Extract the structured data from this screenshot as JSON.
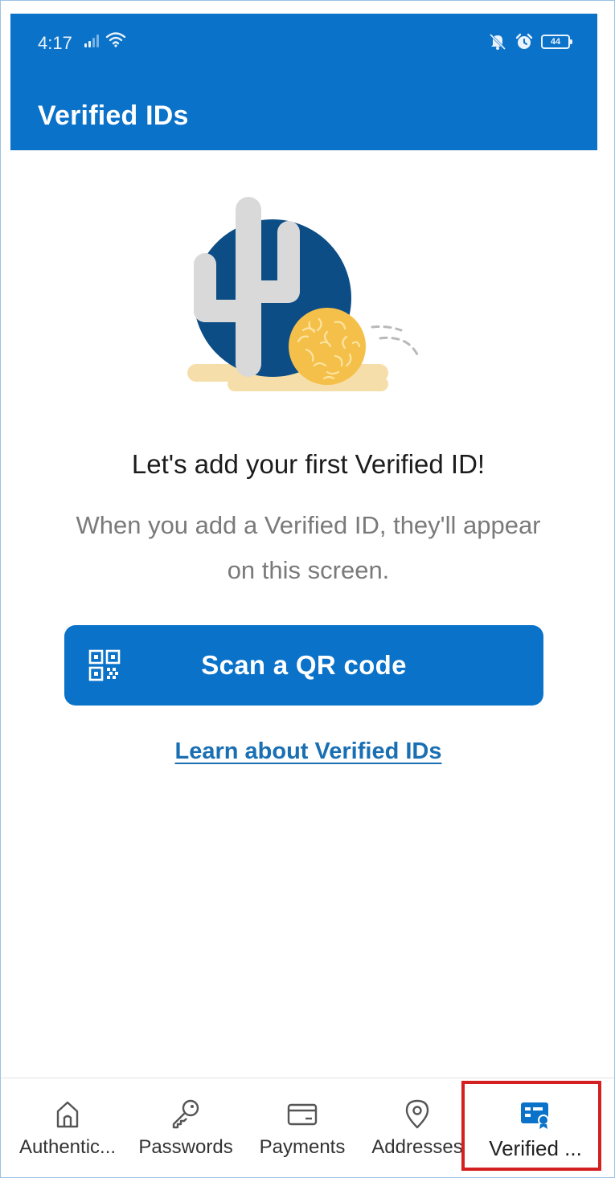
{
  "status_bar": {
    "time": "4:17",
    "battery": "44"
  },
  "header": {
    "title": "Verified IDs"
  },
  "empty_state": {
    "title": "Let's add your first Verified ID!",
    "subtitle": "When you add a Verified ID, they'll appear on this screen."
  },
  "actions": {
    "scan_label": "Scan a QR code",
    "learn_link": "Learn about Verified IDs"
  },
  "colors": {
    "brand": "#0a72c9",
    "link": "#1a6fb3",
    "highlight": "#d42020"
  },
  "bottom_nav": {
    "items": [
      {
        "label": "Authentic...",
        "icon": "home-icon"
      },
      {
        "label": "Passwords",
        "icon": "key-icon"
      },
      {
        "label": "Payments",
        "icon": "card-icon"
      },
      {
        "label": "Addresses",
        "icon": "location-pin-icon"
      },
      {
        "label": "Verified ...",
        "icon": "verified-id-icon",
        "active": true
      }
    ]
  }
}
